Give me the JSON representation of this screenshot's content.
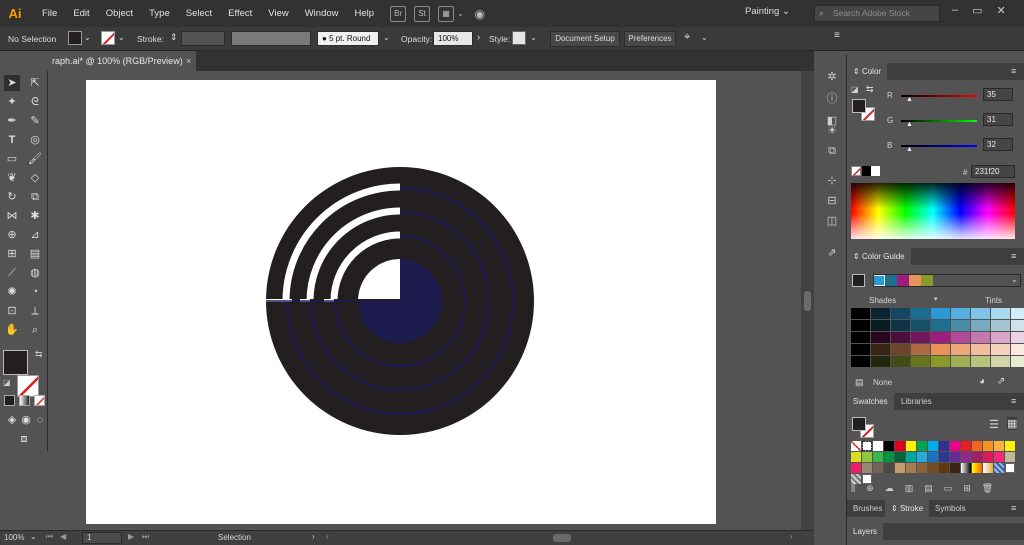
{
  "app": {
    "logo": "Ai",
    "menus": [
      "File",
      "Edit",
      "Object",
      "Type",
      "Select",
      "Effect",
      "View",
      "Window",
      "Help"
    ],
    "bridge_label": "Br",
    "stock_label": "St",
    "workspace": "Painting",
    "search_placeholder": "Search Adobe Stock"
  },
  "control_bar": {
    "selection_label": "No Selection",
    "stroke_label": "Stroke:",
    "brush_label": "5 pt. Round",
    "opacity_label": "Opacity:",
    "opacity_value": "100%",
    "style_label": "Style:",
    "document_setup": "Document Setup",
    "preferences": "Preferences"
  },
  "document": {
    "tab_title": "raph.ai* @ 100% (RGB/Preview)",
    "close_glyph": "×"
  },
  "status_bar": {
    "zoom": "100%",
    "artboard_number": "1",
    "tool_name": "Selection"
  },
  "color_panel": {
    "title": "Color",
    "r_label": "R",
    "r_value": "35",
    "g_label": "G",
    "g_value": "31",
    "b_label": "B",
    "b_value": "32",
    "hex_label": "#",
    "hex_value": "231f20"
  },
  "color_guide": {
    "title": "Color Guide",
    "shades_label": "Shades",
    "tints_label": "Tints",
    "none_label": "None"
  },
  "swatches_panel": {
    "tabs": [
      "Swatches",
      "Libraries"
    ]
  },
  "bottom_tabs": {
    "tabs": [
      "Brushes",
      "Stroke",
      "Symbols"
    ],
    "layers": "Layers"
  },
  "colors": {
    "art_dark": "#231f20",
    "art_navy": "#1e1b4f",
    "accent_orange": "#ff9a00"
  }
}
